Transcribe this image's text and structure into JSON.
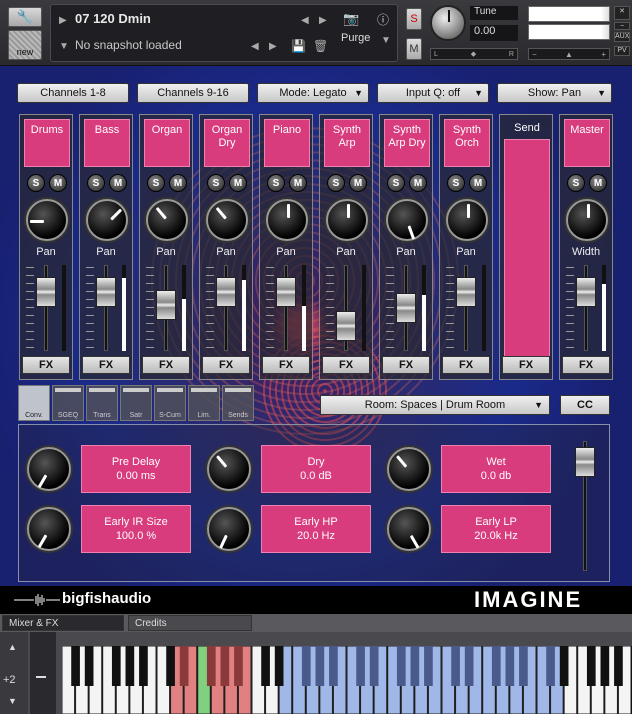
{
  "header": {
    "instrument_name": "07 120 Dmin",
    "snapshot": "No snapshot loaded",
    "purge_label": "Purge",
    "new_label": "new",
    "solo_label": "S",
    "mute_label": "M",
    "tune_label": "Tune",
    "tune_value": "0.00",
    "lr_left": "L",
    "lr_right": "R",
    "vol_minus": "−",
    "vol_plus": "+",
    "aux_label": "AUX",
    "pv_label": "PV"
  },
  "top_buttons": [
    {
      "label": "Channels 1-8"
    },
    {
      "label": "Channels 9-16"
    },
    {
      "label": "Mode: Legato"
    },
    {
      "label": "Input Q: off"
    },
    {
      "label": "Show: Pan"
    }
  ],
  "channels": [
    {
      "name": "Drums",
      "knob": "Pan",
      "knob_angle": -90,
      "fader": 0.78,
      "meter": 0.0
    },
    {
      "name": "Bass",
      "knob": "Pan",
      "knob_angle": 45,
      "fader": 0.78,
      "meter": 0.85
    },
    {
      "name": "Organ",
      "knob": "Pan",
      "knob_angle": -40,
      "fader": 0.55,
      "meter": 0.6
    },
    {
      "name": "Organ Dry",
      "knob": "Pan",
      "knob_angle": -40,
      "fader": 0.78,
      "meter": 0.82
    },
    {
      "name": "Piano",
      "knob": "Pan",
      "knob_angle": 0,
      "fader": 0.78,
      "meter": 0.52
    },
    {
      "name": "Synth Arp",
      "knob": "Pan",
      "knob_angle": 0,
      "fader": 0.18,
      "meter": 0.0
    },
    {
      "name": "Synth Arp Dry",
      "knob": "Pan",
      "knob_angle": 160,
      "fader": 0.5,
      "meter": 0.65
    },
    {
      "name": "Synth Orch",
      "knob": "Pan",
      "knob_angle": 0,
      "fader": 0.78,
      "meter": 0.0
    }
  ],
  "send": {
    "name": "Send"
  },
  "master": {
    "name": "Master",
    "knob": "Width",
    "knob_angle": 0,
    "fader": 0.78,
    "meter": 0.78
  },
  "solo_glyph": "S",
  "mute_glyph": "M",
  "fx_label": "FX",
  "fx_tabs": [
    {
      "label": "Conv.",
      "active": true
    },
    {
      "label": "SGEQ",
      "active": false
    },
    {
      "label": "Trans",
      "active": false
    },
    {
      "label": "Satr",
      "active": false
    },
    {
      "label": "S-Cum",
      "active": false
    },
    {
      "label": "Lim.",
      "active": false
    },
    {
      "label": "Sends",
      "active": false
    }
  ],
  "room_select": "Room: Spaces | Drum Room",
  "cc_label": "CC",
  "reverb": {
    "pre_delay": {
      "label": "Pre Delay",
      "value": "0.00 ms",
      "knob_angle": -150
    },
    "dry": {
      "label": "Dry",
      "value": "0.0 dB",
      "knob_angle": -40
    },
    "wet": {
      "label": "Wet",
      "value": "0.0 db",
      "knob_angle": -40
    },
    "early_ir_size": {
      "label": "Early IR Size",
      "value": "100.0 %",
      "knob_angle": -150
    },
    "early_hp": {
      "label": "Early HP",
      "value": "20.0 Hz",
      "knob_angle": -155
    },
    "early_lp": {
      "label": "Early LP",
      "value": "20.0k Hz",
      "knob_angle": 150
    }
  },
  "brand_left": "bigfishaudio",
  "brand_right": "IMAGINE",
  "tabs": [
    {
      "label": "Mixer & FX"
    },
    {
      "label": "Credits"
    }
  ],
  "keyboard": {
    "octave": "+2",
    "colors": {
      "red_zone": "#e08080",
      "green_key": "#80d080",
      "blue_zone": "#9fb8e8"
    }
  }
}
